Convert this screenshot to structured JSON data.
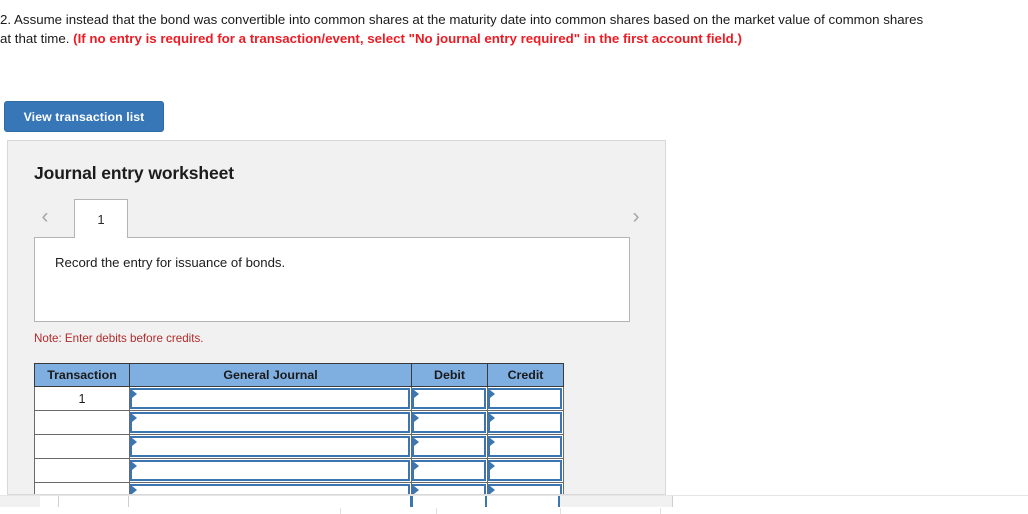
{
  "question": {
    "number": "2.",
    "body": "2. Assume instead that the bond was convertible into common shares at the maturity date into common shares based on the market value of common shares at that time. ",
    "red_note": "(If no entry is required for a transaction/event, select \"No journal entry required\" in the first account field.)"
  },
  "toolbar": {
    "view_transaction_list_label": "View transaction list"
  },
  "worksheet": {
    "title": "Journal entry worksheet",
    "prev_arrow_icon": "chevron-left-icon",
    "next_arrow_icon": "chevron-right-icon",
    "prev_arrow_glyph": "‹",
    "next_arrow_glyph": "›",
    "tabs": [
      {
        "label": "1",
        "active": true
      }
    ],
    "entry_description": "Record the entry for issuance of bonds.",
    "debits_note": "Note: Enter debits before credits."
  },
  "journal_table": {
    "columns": [
      "Transaction",
      "General Journal",
      "Debit",
      "Credit"
    ],
    "rows": [
      {
        "transaction": "1",
        "general_journal": "",
        "debit": "",
        "credit": ""
      },
      {
        "transaction": "",
        "general_journal": "",
        "debit": "",
        "credit": ""
      },
      {
        "transaction": "",
        "general_journal": "",
        "debit": "",
        "credit": ""
      },
      {
        "transaction": "",
        "general_journal": "",
        "debit": "",
        "credit": ""
      },
      {
        "transaction": "",
        "general_journal": "",
        "debit": "",
        "credit": ""
      }
    ]
  },
  "colors": {
    "accent_blue": "#3777B8",
    "header_blue": "#7FAEE0",
    "input_border_blue": "#3B76B0",
    "alert_red": "#ED1C24",
    "note_red": "#B02B2B",
    "panel_gray": "#F1F1F1"
  }
}
